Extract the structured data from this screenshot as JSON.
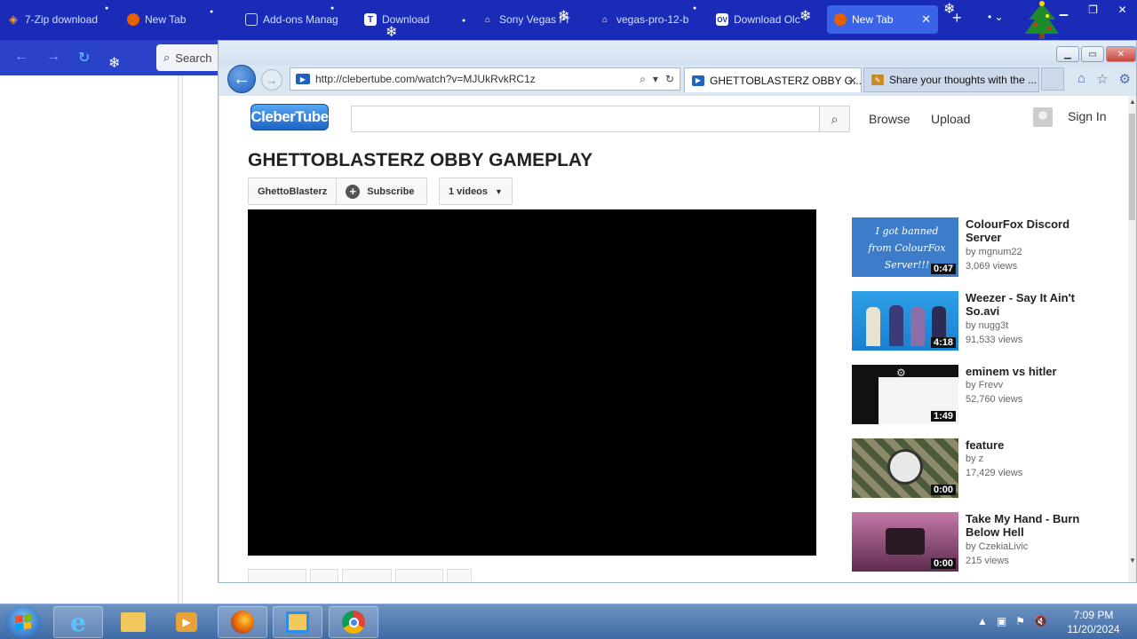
{
  "firefox": {
    "tabs": [
      {
        "label": "7-Zip download",
        "icon": "7zip-icon"
      },
      {
        "label": "New Tab",
        "icon": "firefox-icon"
      },
      {
        "label": "Add-ons Manag",
        "icon": "puzzle-icon"
      },
      {
        "label": "Download",
        "icon": "download-site-icon"
      },
      {
        "label": "Sony Vegas Pr",
        "icon": "building-icon"
      },
      {
        "label": "vegas-pro-12-b",
        "icon": "building-icon"
      },
      {
        "label": "Download Olc",
        "icon": "ov-icon"
      },
      {
        "label": "New Tab",
        "icon": "firefox-icon",
        "active": true
      }
    ],
    "search_placeholder": "Search"
  },
  "ie": {
    "address": "http://clebertube.com/watch?v=MJUkRvkRC1z",
    "tabs": [
      {
        "label": "GHETTOBLASTERZ OBBY G...",
        "active": true
      },
      {
        "label": "Share your thoughts with the ..."
      }
    ]
  },
  "page": {
    "logo": "CleberTube",
    "nav": {
      "browse": "Browse",
      "upload": "Upload",
      "sign_in": "Sign In"
    },
    "video_title": "GHETTOBLASTERZ OBBY GAMEPLAY",
    "channel": "GhettoBlasterz",
    "subscribe": "Subscribe",
    "videos_count": "1 videos",
    "recommendations": [
      {
        "title": "ColourFox Discord Server",
        "by": "by mgnum22",
        "views": "3,069 views",
        "duration": "0:47",
        "thumb_text": "I got banned from ColourFox Server!!!"
      },
      {
        "title": "Weezer - Say It Ain't So.avi",
        "by": "by nugg3t",
        "views": "91,533 views",
        "duration": "4:18"
      },
      {
        "title": "eminem vs hitler",
        "by": "by Frevv",
        "views": "52,760 views",
        "duration": "1:49"
      },
      {
        "title": "feature",
        "by": "by z",
        "views": "17,429 views",
        "duration": "0:00"
      },
      {
        "title": "Take My Hand - Burn Below Hell",
        "by": "by CzekiaLivic",
        "views": "215 views",
        "duration": "0:00"
      }
    ]
  },
  "taskbar": {
    "time": "7:09 PM",
    "date": "11/20/2024"
  }
}
